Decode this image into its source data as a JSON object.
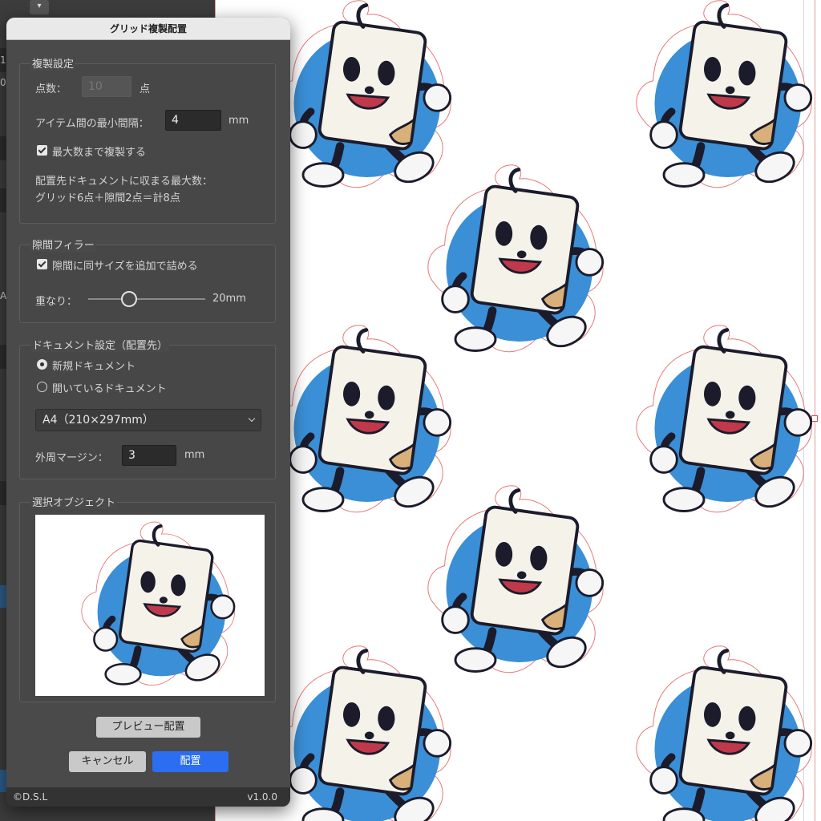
{
  "dialog": {
    "title": "グリッド複製配置",
    "copy_settings": {
      "legend": "複製設定",
      "count_label": "点数：",
      "count_value": "10",
      "count_unit": "点",
      "min_gap_label": "アイテム間の最小間隔：",
      "min_gap_value": "4",
      "min_gap_unit": "mm",
      "max_copy_label": "最大数まで複製する",
      "max_copy_checked": true,
      "info_line1": "配置先ドキュメントに収まる最大数：",
      "info_line2": "グリッド6点＋隙間2点＝計8点"
    },
    "gap_filler": {
      "legend": "隙間フィラー",
      "fill_label": "隙間に同サイズを追加で詰める",
      "fill_checked": true,
      "overlap_label": "重なり：",
      "overlap_value": "20mm",
      "overlap_fraction": 0.35
    },
    "document_settings": {
      "legend": "ドキュメント設定（配置先）",
      "new_doc_label": "新規ドキュメント",
      "open_doc_label": "開いているドキュメント",
      "selected": "new",
      "paper_size": "A4（210×297mm）",
      "margin_label": "外周マージン：",
      "margin_value": "3",
      "margin_unit": "mm"
    },
    "selected_object": {
      "legend": "選択オブジェクト"
    },
    "preview_button": "プレビュー配置",
    "cancel_button": "キャンセル",
    "place_button": "配置",
    "footer_left": "©D.S.L",
    "footer_right": "v1.0.0"
  },
  "app_strip": {
    "glyph_1": "1",
    "glyph_2": "0",
    "glyph_3": "A"
  },
  "colors": {
    "accent": "#2b6ef2",
    "sticker_blue": "#3a8fd6",
    "paper": "#f5f2ea",
    "dialog_bg": "#4a4a4a"
  }
}
